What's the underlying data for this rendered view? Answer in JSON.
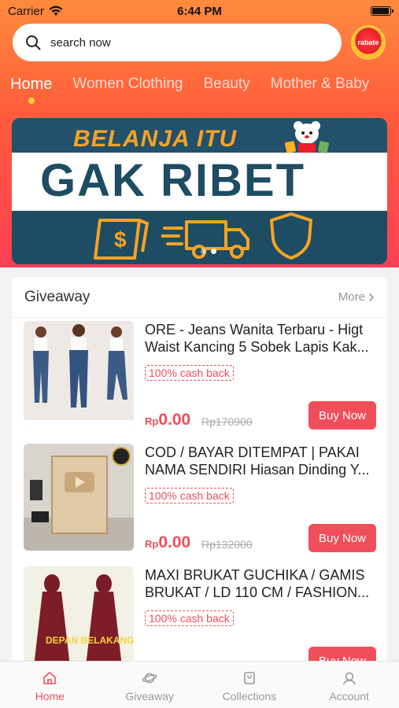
{
  "status_bar": {
    "carrier": "Carrier",
    "time": "6:44 PM"
  },
  "search": {
    "placeholder": "search now"
  },
  "rebate_badge": {
    "label": "rabate"
  },
  "tabs": [
    {
      "label": "Home",
      "active": true
    },
    {
      "label": "Women Clothing",
      "active": false
    },
    {
      "label": "Beauty",
      "active": false
    },
    {
      "label": "Mother & Baby",
      "active": false
    }
  ],
  "banner": {
    "line1": "BELANJA ITU",
    "line2": "GAK RIBET",
    "slides": 2,
    "current_slide": 2
  },
  "giveaway": {
    "title": "Giveaway",
    "more_label": "More",
    "items": [
      {
        "title": "ORE - Jeans Wanita Terbaru - Higt Waist Kancing 5 Sobek Lapis Kak...",
        "cashback": "100% cash back",
        "currency": "Rp",
        "price": "0.00",
        "original_price": "Rp170900",
        "buy_label": "Buy Now",
        "thumb_icon": "jeans-photo"
      },
      {
        "title": "COD / BAYAR DITEMPAT | PAKAI NAMA SENDIRI Hiasan Dinding Y...",
        "cashback": "100% cash back",
        "currency": "Rp",
        "price": "0.00",
        "original_price": "Rp132000",
        "buy_label": "Buy Now",
        "thumb_icon": "youtube-plaque-photo"
      },
      {
        "title": "MAXI BRUKAT GUCHIKA / GAMIS BRUKAT / LD 110 CM / FASHION...",
        "cashback": "100% cash back",
        "currency": "Rp",
        "price": "",
        "original_price": "",
        "buy_label": "Buy Now",
        "thumb_icon": "dress-photo",
        "thumb_text": "DEPAN BELAKANG"
      }
    ]
  },
  "bottom_nav": [
    {
      "label": "Home",
      "icon": "home-icon",
      "active": true
    },
    {
      "label": "Giveaway",
      "icon": "planet-icon",
      "active": false
    },
    {
      "label": "Collections",
      "icon": "bag-icon",
      "active": false
    },
    {
      "label": "Account",
      "icon": "user-icon",
      "active": false
    }
  ],
  "colors": {
    "accent": "#f04e5a",
    "gradient_top": "#ff8a3d",
    "gradient_bottom": "#ff3f55",
    "banner_navy": "#1d4c63",
    "banner_orange": "#f7a325"
  }
}
